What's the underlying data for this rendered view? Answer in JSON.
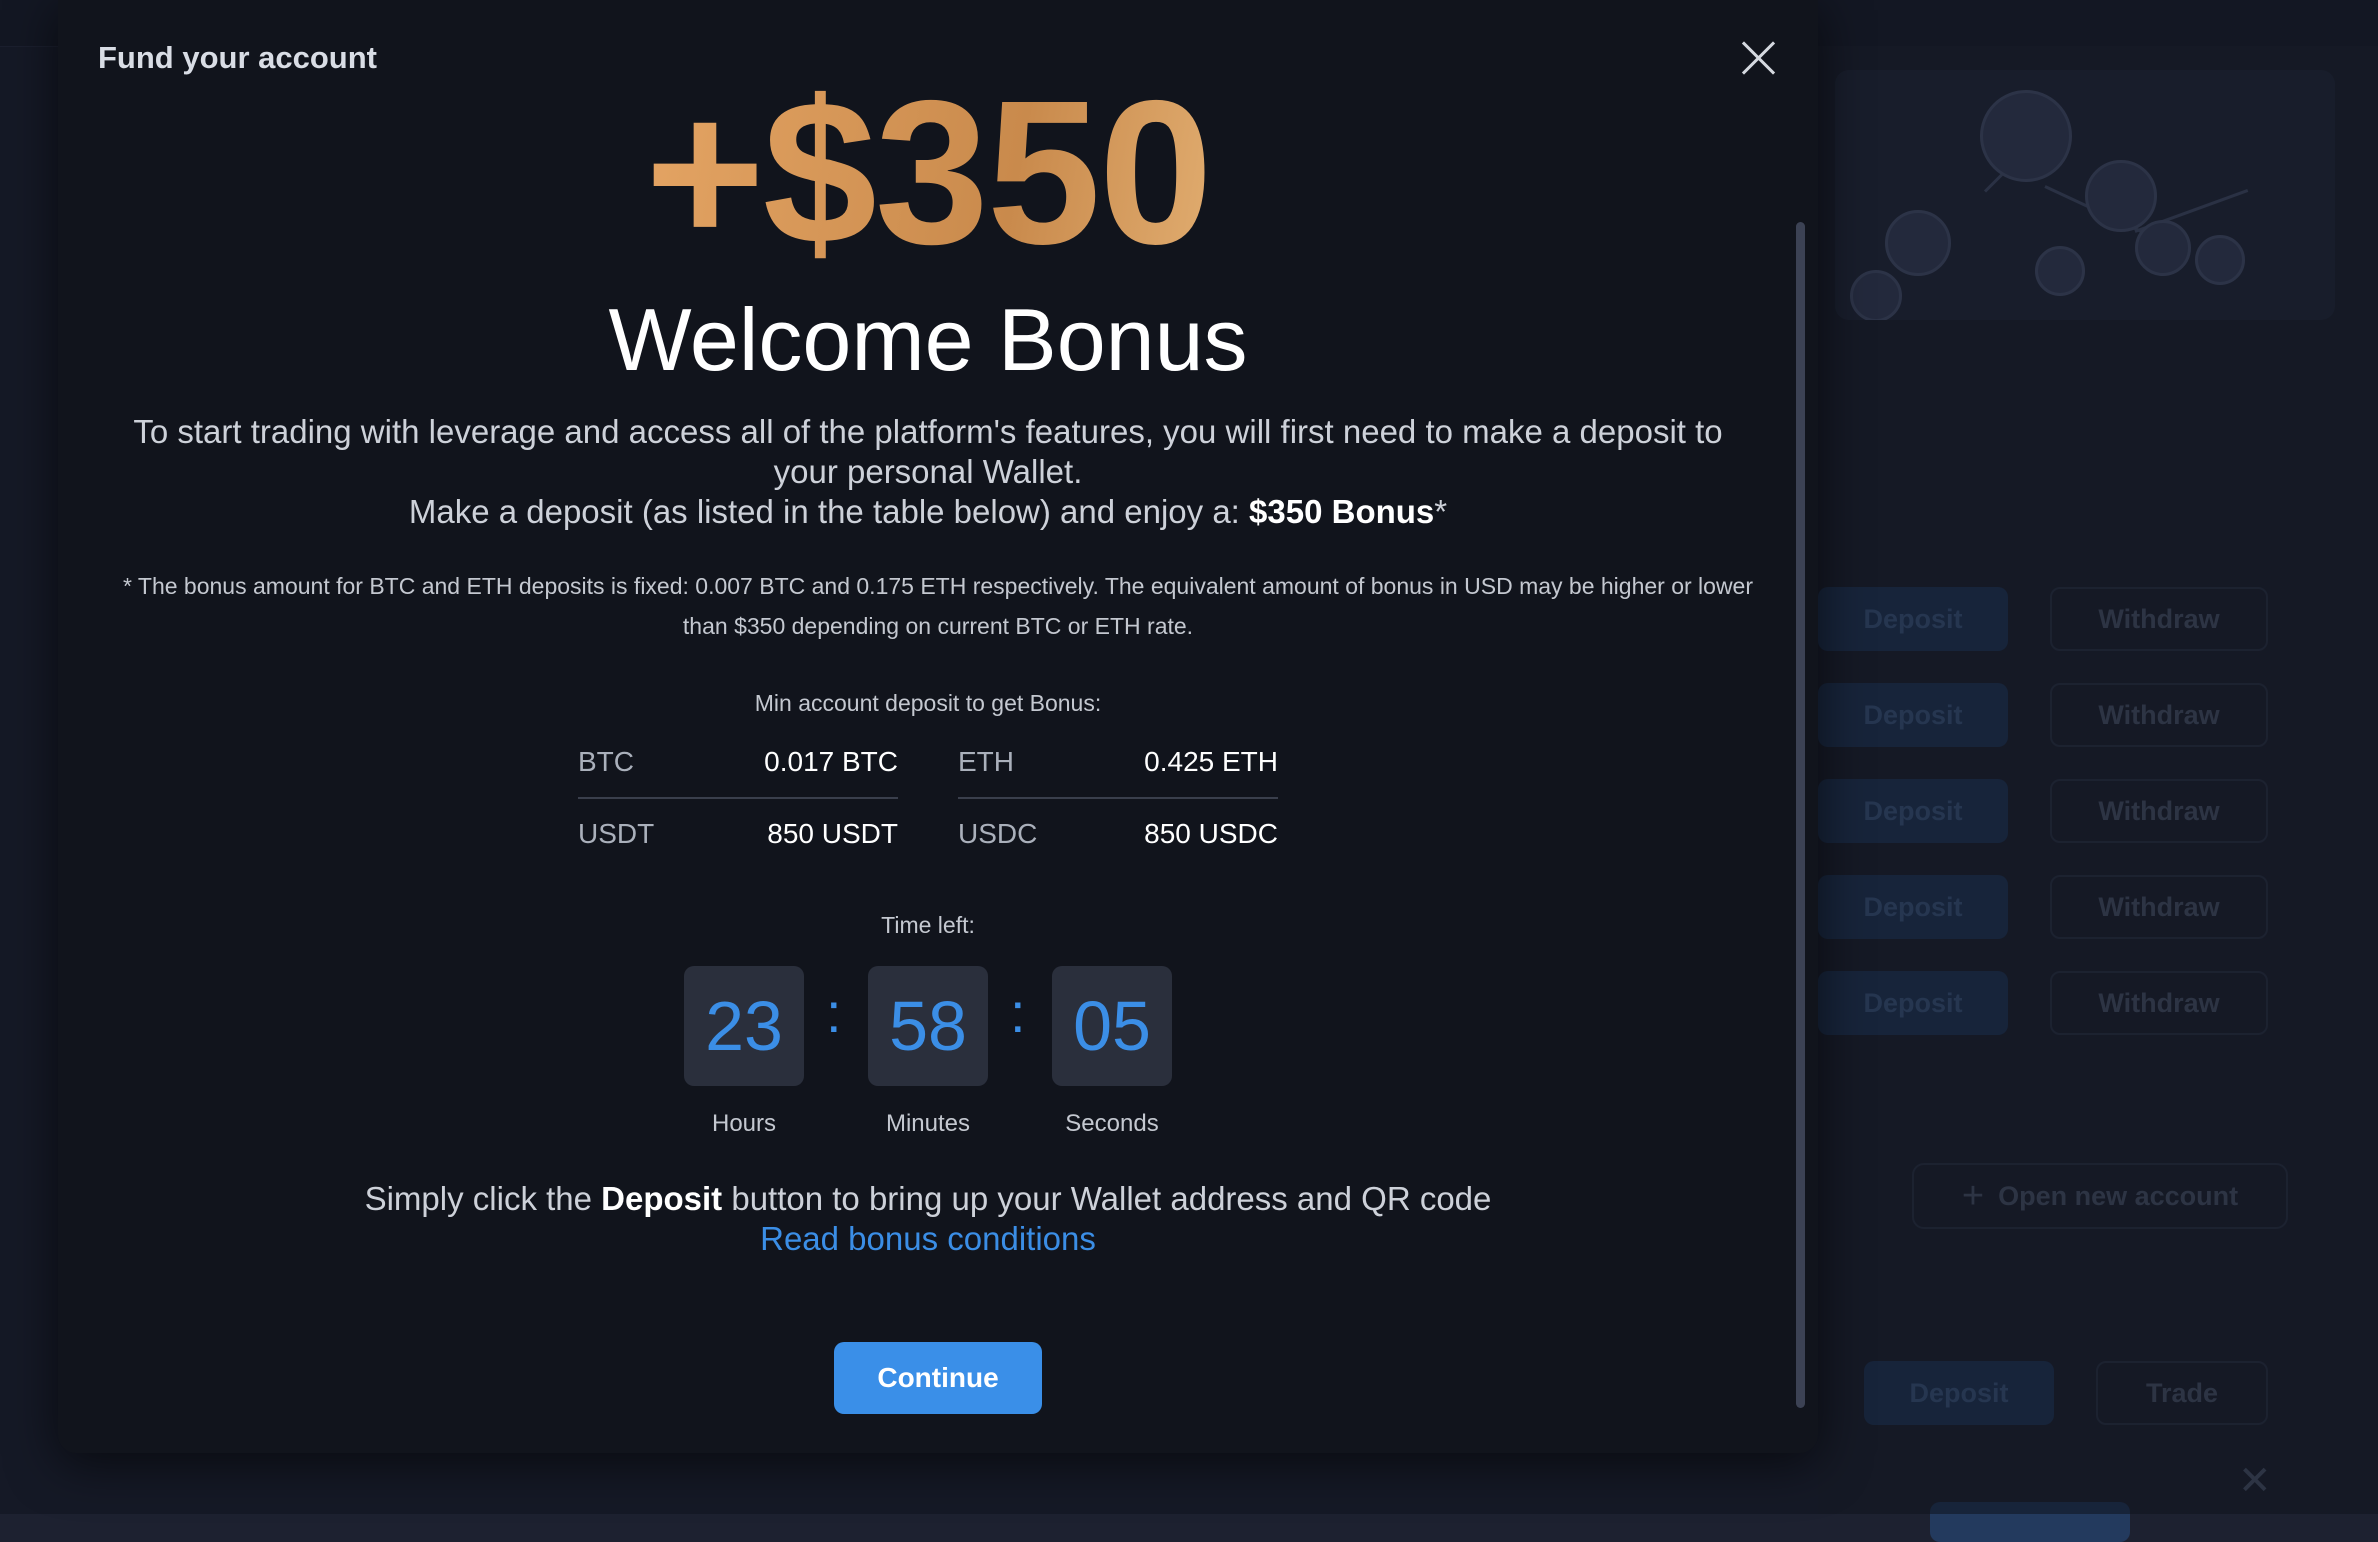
{
  "modal": {
    "title": "Fund your account",
    "bonus_amount": "+$350",
    "headline": "Welcome Bonus",
    "description_line1": "To start trading with leverage and access all of the platform's features, you will first need to make a deposit to your personal Wallet.",
    "description_line2_prefix": "Make a deposit (as listed in the table below) and enjoy a: ",
    "description_line2_bonus": "$350 Bonus",
    "description_line2_suffix": "*",
    "fine_print": "* The bonus amount for BTC and ETH deposits is fixed: 0.007 BTC and 0.175 ETH respectively. The equivalent amount of bonus in USD may be higher or lower than $350 depending on current BTC or ETH rate.",
    "min_deposit_label": "Min account deposit to get Bonus:",
    "deposits": [
      {
        "currency": "BTC",
        "amount": "0.017 BTC"
      },
      {
        "currency": "ETH",
        "amount": "0.425 ETH"
      },
      {
        "currency": "USDT",
        "amount": "850 USDT"
      },
      {
        "currency": "USDC",
        "amount": "850 USDC"
      }
    ],
    "time_left_label": "Time left:",
    "timer": {
      "hours": "23",
      "minutes": "58",
      "seconds": "05",
      "separator": ":",
      "hours_label": "Hours",
      "minutes_label": "Minutes",
      "seconds_label": "Seconds"
    },
    "instruction_prefix": "Simply click the ",
    "instruction_bold": "Deposit",
    "instruction_suffix": " button to bring up your Wallet address and QR code",
    "conditions_link": "Read bonus conditions",
    "continue_label": "Continue",
    "icons": {
      "close": "close-icon"
    }
  },
  "background": {
    "deposit_label": "Deposit",
    "withdraw_label": "Withdraw",
    "trade_label": "Trade",
    "open_account_label": "Open new account",
    "open_account_icon": "plus-icon",
    "colors": {
      "accent": "#3a8fe8",
      "gold": "#e8a867"
    }
  }
}
